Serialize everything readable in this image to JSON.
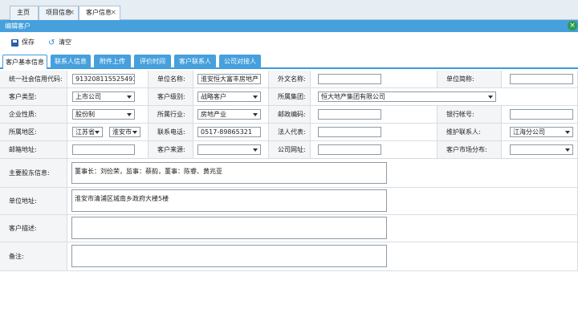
{
  "tabs": [
    {
      "label": "主页",
      "closable": false
    },
    {
      "label": "项目信息",
      "closable": true
    },
    {
      "label": "客户信息",
      "closable": true,
      "active": true
    }
  ],
  "panel": {
    "title": "编辑客户"
  },
  "toolbar": {
    "save_label": "保存",
    "clear_label": "清空"
  },
  "subtabs": [
    "客户基本信息",
    "联系人信息",
    "附件上传",
    "评价时间",
    "客户联系人",
    "公司对接人"
  ],
  "form": {
    "credit_code_label": "统一社会信用代码:",
    "credit_code_value": "913208115525493",
    "company_name_label": "单位名称:",
    "company_name_value": "淮安恒大富丰房地产",
    "foreign_name_label": "外文名称:",
    "foreign_name_value": "",
    "short_name_label": "单位简称:",
    "short_name_value": "",
    "customer_type_label": "客户类型:",
    "customer_type_value": "上市公司",
    "customer_level_label": "客户级别:",
    "customer_level_value": "战略客户",
    "group_label": "所属集团:",
    "group_value": "恒大地产集团有限公司",
    "nature_label": "企业性质:",
    "nature_value": "股份制",
    "industry_label": "所属行业:",
    "industry_value": "房地产业",
    "postcode_label": "邮政编码:",
    "postcode_value": "",
    "bank_label": "银行帐号:",
    "bank_value": "",
    "region_label": "所属地区:",
    "province_value": "江苏省",
    "city_value": "淮安市",
    "phone_label": "联系电话:",
    "phone_value": "0517-89865321",
    "legal_label": "法人代表:",
    "legal_value": "",
    "maintainer_label": "维护联系人:",
    "maintainer_value": "江海分公司",
    "email_label": "邮箱地址:",
    "email_value": "",
    "source_label": "客户来源:",
    "source_value": "",
    "website_label": "公司网址:",
    "website_value": "",
    "market_label": "客户市场分布:",
    "market_value": "",
    "shareholder_label": "主要股东信息:",
    "shareholder_value": "董事长：刘俭荣，监事：蔡韵，董事：陈睿、黄兆亚",
    "address_label": "单位地址:",
    "address_value": "淮安市清浦区城南乡政府大楼5楼",
    "description_label": "客户描述:",
    "description_value": "",
    "remark_label": "备注:",
    "remark_value": ""
  }
}
